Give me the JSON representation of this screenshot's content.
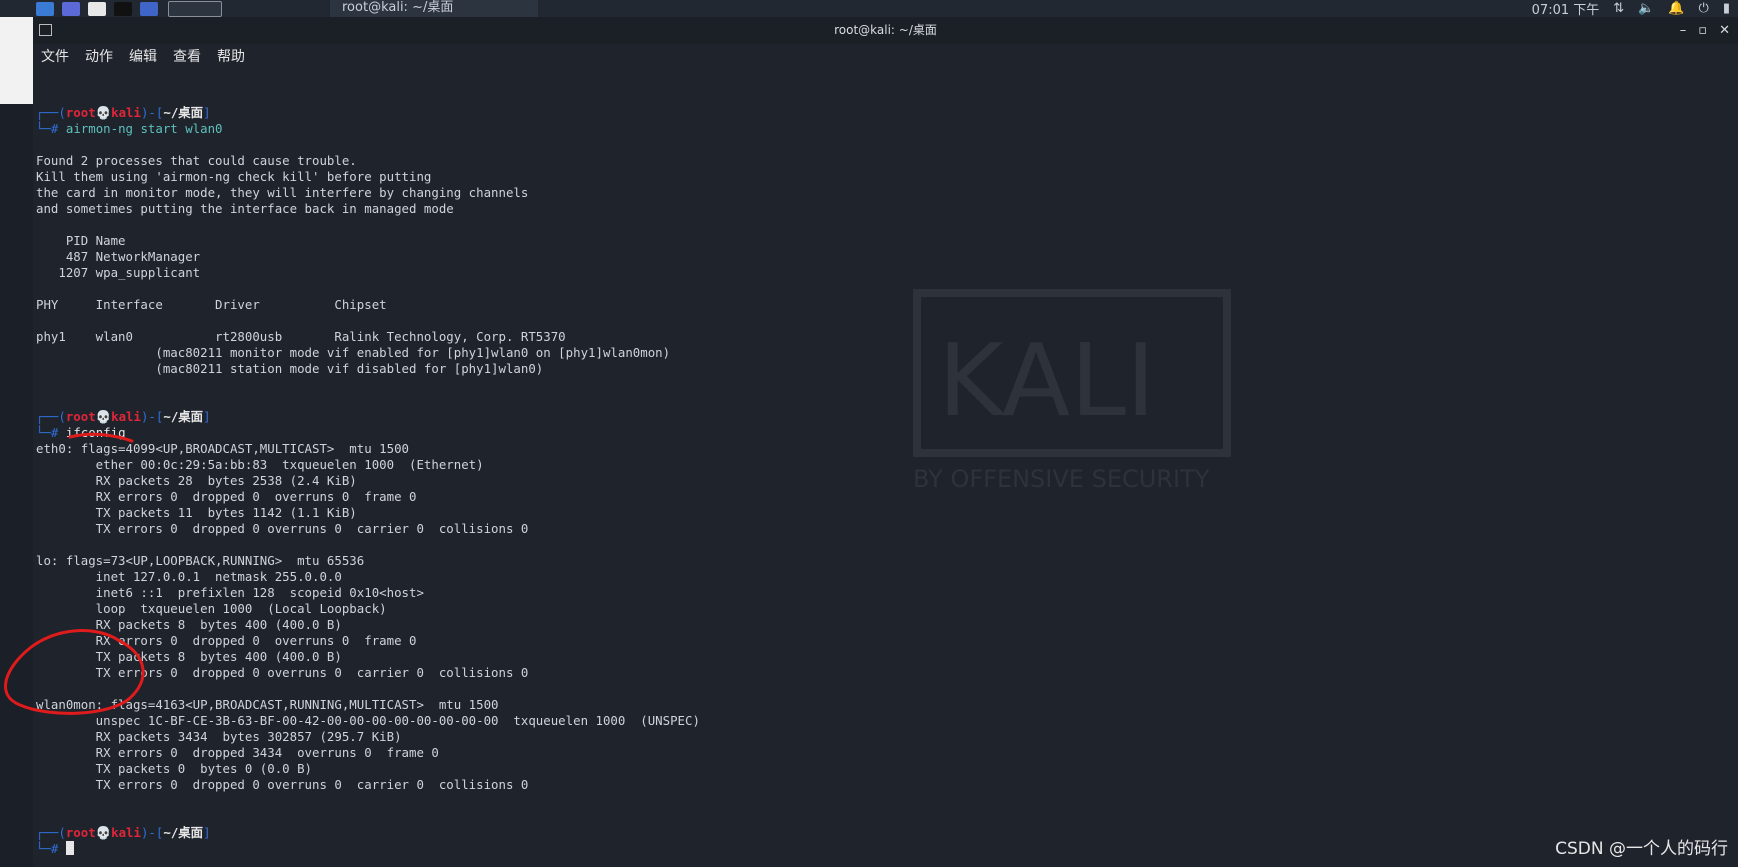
{
  "taskbar": {
    "task_title": "root@kali: ~/桌面",
    "clock": "07:01 下午"
  },
  "window": {
    "title": "root@kali: ~/桌面"
  },
  "menu": [
    "文件",
    "动作",
    "编辑",
    "查看",
    "帮助"
  ],
  "prompt": {
    "user": "root",
    "skull": "💀",
    "host": "kali",
    "dir": "~/桌面",
    "open": "┌──(",
    "mid": ")-[",
    "close": "]",
    "hashprefix": "└─#"
  },
  "commands": {
    "first": "airmon-ng start wlan0",
    "second": "ifconfig"
  },
  "airmon_output": [
    "Found 2 processes that could cause trouble.",
    "Kill them using 'airmon-ng check kill' before putting",
    "the card in monitor mode, they will interfere by changing channels",
    "and sometimes putting the interface back in managed mode",
    "",
    "    PID Name",
    "    487 NetworkManager",
    "   1207 wpa_supplicant",
    "",
    "PHY     Interface       Driver          Chipset",
    "",
    "phy1    wlan0           rt2800usb       Ralink Technology, Corp. RT5370",
    "                (mac80211 monitor mode vif enabled for [phy1]wlan0 on [phy1]wlan0mon)",
    "                (mac80211 station mode vif disabled for [phy1]wlan0)",
    "",
    ""
  ],
  "ifconfig_output": [
    "eth0: flags=4099<UP,BROADCAST,MULTICAST>  mtu 1500",
    "        ether 00:0c:29:5a:bb:83  txqueuelen 1000  (Ethernet)",
    "        RX packets 28  bytes 2538 (2.4 KiB)",
    "        RX errors 0  dropped 0  overruns 0  frame 0",
    "        TX packets 11  bytes 1142 (1.1 KiB)",
    "        TX errors 0  dropped 0 overruns 0  carrier 0  collisions 0",
    "",
    "lo: flags=73<UP,LOOPBACK,RUNNING>  mtu 65536",
    "        inet 127.0.0.1  netmask 255.0.0.0",
    "        inet6 ::1  prefixlen 128  scopeid 0x10<host>",
    "        loop  txqueuelen 1000  (Local Loopback)",
    "        RX packets 8  bytes 400 (400.0 B)",
    "        RX errors 0  dropped 0  overruns 0  frame 0",
    "        TX packets 8  bytes 400 (400.0 B)",
    "        TX errors 0  dropped 0 overruns 0  carrier 0  collisions 0",
    "",
    "wlan0mon: flags=4163<UP,BROADCAST,RUNNING,MULTICAST>  mtu 1500",
    "        unspec 1C-BF-CE-3B-63-BF-00-42-00-00-00-00-00-00-00-00  txqueuelen 1000  (UNSPEC)",
    "        RX packets 3434  bytes 302857 (295.7 KiB)",
    "        RX errors 0  dropped 3434  overruns 0  frame 0",
    "        TX packets 0  bytes 0 (0.0 B)",
    "        TX errors 0  dropped 0 overruns 0  carrier 0  collisions 0",
    "",
    ""
  ],
  "background_logo": {
    "word": "KALI",
    "tagline": "BY OFFENSIVE SECURITY"
  },
  "watermark": "CSDN @一个人的码行"
}
